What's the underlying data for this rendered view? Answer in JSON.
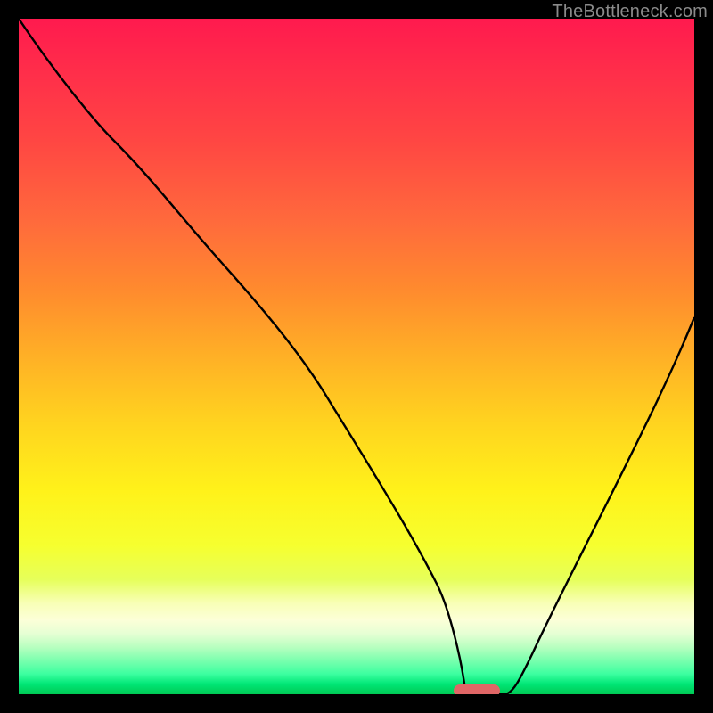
{
  "watermark": "TheBottleneck.com",
  "chart_data": {
    "type": "line",
    "title": "",
    "xlabel": "",
    "ylabel": "",
    "xlim": [
      0,
      100
    ],
    "ylim": [
      0,
      100
    ],
    "grid": false,
    "series": [
      {
        "name": "curve",
        "x": [
          0,
          8,
          14,
          22,
          30,
          38,
          46,
          53,
          59,
          62,
          64,
          66,
          68,
          70,
          72,
          76,
          82,
          88,
          94,
          100
        ],
        "values": [
          100,
          90,
          82,
          72,
          64,
          54,
          44,
          34,
          24,
          16,
          10,
          4,
          0,
          0,
          0,
          6,
          18,
          32,
          48,
          66
        ]
      }
    ],
    "marker": {
      "x_start": 64.5,
      "x_end": 70.5,
      "y": 0
    },
    "gradient_stops": [
      {
        "pct": 0,
        "color": "#ff1a4e"
      },
      {
        "pct": 8,
        "color": "#ff2e4a"
      },
      {
        "pct": 18,
        "color": "#ff4643"
      },
      {
        "pct": 30,
        "color": "#ff6a3c"
      },
      {
        "pct": 40,
        "color": "#ff8a2e"
      },
      {
        "pct": 50,
        "color": "#ffb026"
      },
      {
        "pct": 60,
        "color": "#ffd41f"
      },
      {
        "pct": 70,
        "color": "#fff21a"
      },
      {
        "pct": 78,
        "color": "#f6ff2f"
      },
      {
        "pct": 83,
        "color": "#e6ff5a"
      },
      {
        "pct": 86.5,
        "color": "#f8ffb6"
      },
      {
        "pct": 89,
        "color": "#fcffd8"
      },
      {
        "pct": 91,
        "color": "#e6ffd4"
      },
      {
        "pct": 93,
        "color": "#b8ffc0"
      },
      {
        "pct": 95,
        "color": "#7affae"
      },
      {
        "pct": 97,
        "color": "#3cffa0"
      },
      {
        "pct": 98.5,
        "color": "#00e676"
      },
      {
        "pct": 100,
        "color": "#00c853"
      }
    ]
  }
}
